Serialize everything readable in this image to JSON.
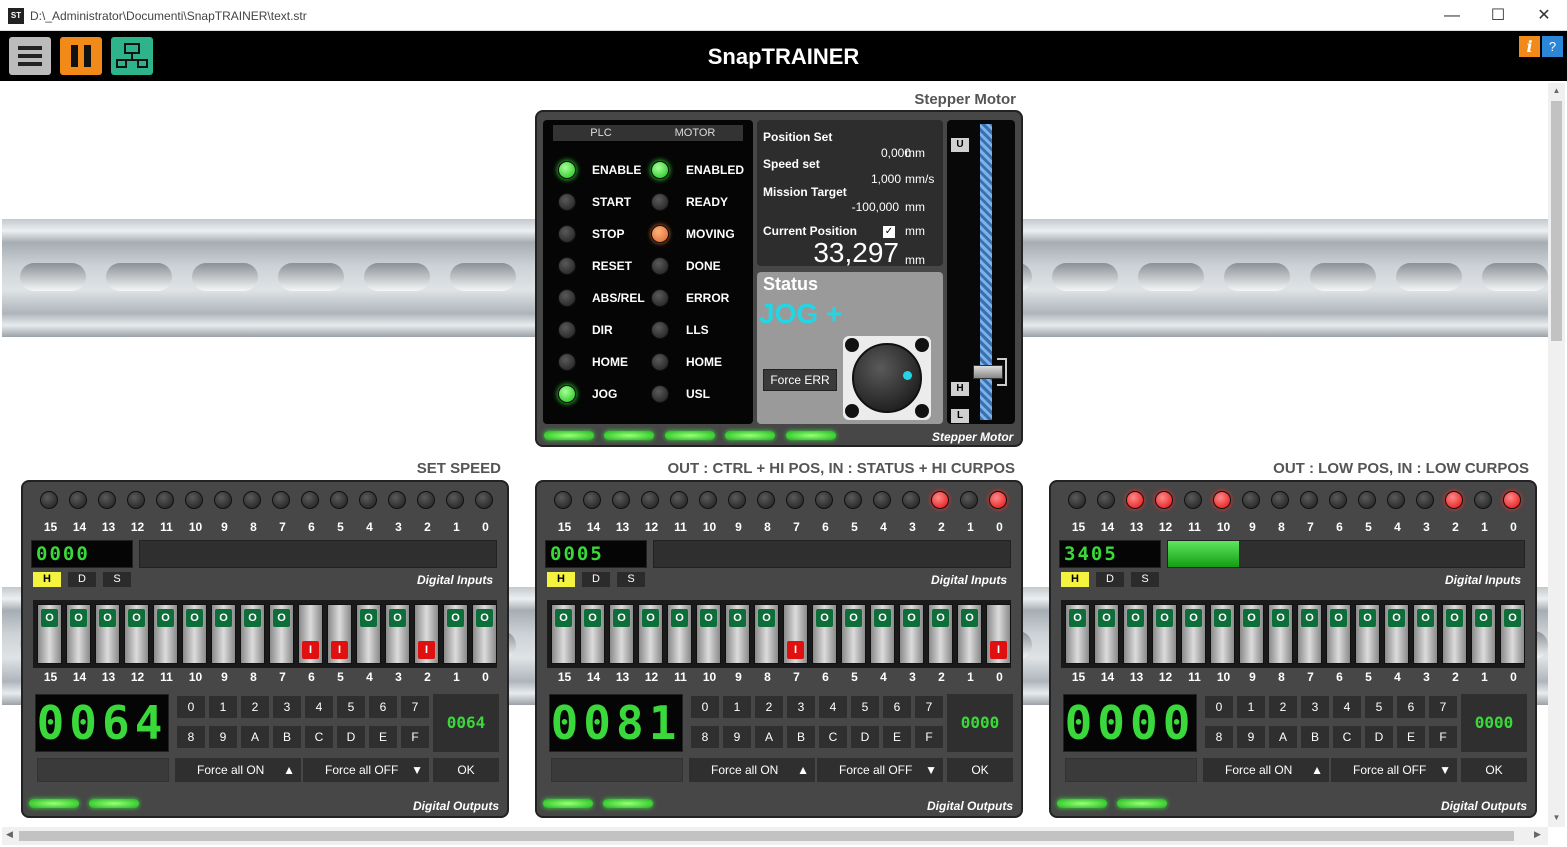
{
  "window": {
    "path": "D:\\_Administrator\\Documenti\\SnapTRAINER\\text.str",
    "app_icon_text": "ST",
    "minimize": "—",
    "maximize": "☐",
    "close": "✕"
  },
  "toolbar": {
    "title": "SnapTRAINER",
    "info_label": "i",
    "help_label": "?"
  },
  "stepper": {
    "heading": "Stepper Motor",
    "footer": "Stepper Motor",
    "plc_header": "PLC",
    "motor_header": "MOTOR",
    "plc_items": [
      {
        "label": "ENABLE",
        "state": "green"
      },
      {
        "label": "START",
        "state": "off"
      },
      {
        "label": "STOP",
        "state": "off"
      },
      {
        "label": "RESET",
        "state": "off"
      },
      {
        "label": "ABS/REL",
        "state": "off"
      },
      {
        "label": "DIR",
        "state": "off"
      },
      {
        "label": "HOME",
        "state": "off"
      },
      {
        "label": "JOG",
        "state": "green"
      }
    ],
    "motor_items": [
      {
        "label": "ENABLED",
        "state": "green"
      },
      {
        "label": "READY",
        "state": "off"
      },
      {
        "label": "MOVING",
        "state": "orange"
      },
      {
        "label": "DONE",
        "state": "off"
      },
      {
        "label": "ERROR",
        "state": "off"
      },
      {
        "label": "LLS",
        "state": "off"
      },
      {
        "label": "HOME",
        "state": "off"
      },
      {
        "label": "USL",
        "state": "off"
      }
    ],
    "position_set_label": "Position Set",
    "position_set_value": "0,000",
    "position_set_unit": "mm",
    "speed_set_label": "Speed set",
    "speed_set_value": "1,000",
    "speed_set_unit": "mm/s",
    "mission_target_label": "Mission Target",
    "mission_target_value": "-100,000",
    "mission_target_unit": "mm",
    "current_position_label": "Current Position",
    "current_position_unit": "mm",
    "current_position_checked": true,
    "current_position_value": "33,297",
    "current_position_value_unit": "mm",
    "status_label": "Status",
    "status_value": "JOG +",
    "force_err_label": "Force ERR",
    "axis_tags": {
      "u": "U",
      "h": "H",
      "l": "L"
    },
    "carriage_position_fraction": 0.83
  },
  "io_panels": [
    {
      "heading": "SET SPEED",
      "leds_on": [],
      "bits": [
        "15",
        "14",
        "13",
        "12",
        "11",
        "10",
        "9",
        "8",
        "7",
        "6",
        "5",
        "4",
        "3",
        "2",
        "1",
        "0"
      ],
      "input_seg": "0000",
      "input_bar_fraction": 0,
      "modes": [
        "H",
        "D",
        "S"
      ],
      "digital_inputs_label": "Digital Inputs",
      "switches_on": [
        6,
        5,
        2
      ],
      "output_seg": "0064",
      "hex_keys": [
        "0",
        "1",
        "2",
        "3",
        "4",
        "5",
        "6",
        "7",
        "8",
        "9",
        "A",
        "B",
        "C",
        "D",
        "E",
        "F"
      ],
      "hex_display": "0064",
      "force_on_label": "Force all ON",
      "force_on_arrow": "▲",
      "force_off_label": "Force all OFF",
      "force_off_arrow": "▼",
      "ok_label": "OK",
      "digital_outputs_label": "Digital Outputs"
    },
    {
      "heading": "OUT : CTRL + HI POS, IN : STATUS + HI CURPOS",
      "leds_on": [
        2,
        0
      ],
      "bits": [
        "15",
        "14",
        "13",
        "12",
        "11",
        "10",
        "9",
        "8",
        "7",
        "6",
        "5",
        "4",
        "3",
        "2",
        "1",
        "0"
      ],
      "input_seg": "0005",
      "input_bar_fraction": 0,
      "modes": [
        "H",
        "D",
        "S"
      ],
      "digital_inputs_label": "Digital Inputs",
      "switches_on": [
        7,
        0
      ],
      "output_seg": "0081",
      "hex_keys": [
        "0",
        "1",
        "2",
        "3",
        "4",
        "5",
        "6",
        "7",
        "8",
        "9",
        "A",
        "B",
        "C",
        "D",
        "E",
        "F"
      ],
      "hex_display": "0000",
      "force_on_label": "Force all ON",
      "force_on_arrow": "▲",
      "force_off_label": "Force all OFF",
      "force_off_arrow": "▼",
      "ok_label": "OK",
      "digital_outputs_label": "Digital Outputs"
    },
    {
      "heading": "OUT : LOW POS, IN : LOW CURPOS",
      "leds_on": [
        13,
        12,
        10,
        2,
        0
      ],
      "bits": [
        "15",
        "14",
        "13",
        "12",
        "11",
        "10",
        "9",
        "8",
        "7",
        "6",
        "5",
        "4",
        "3",
        "2",
        "1",
        "0"
      ],
      "input_seg": "3405",
      "input_bar_fraction": 0.2,
      "modes": [
        "H",
        "D",
        "S"
      ],
      "digital_inputs_label": "Digital Inputs",
      "switches_on": [],
      "output_seg": "0000",
      "hex_keys": [
        "0",
        "1",
        "2",
        "3",
        "4",
        "5",
        "6",
        "7",
        "8",
        "9",
        "A",
        "B",
        "C",
        "D",
        "E",
        "F"
      ],
      "hex_display": "0000",
      "force_on_label": "Force all ON",
      "force_on_arrow": "▲",
      "force_off_label": "Force all OFF",
      "force_off_arrow": "▼",
      "ok_label": "OK",
      "digital_outputs_label": "Digital Outputs"
    }
  ],
  "colors": {
    "led_green": "#14c214",
    "led_red": "#e30b0b",
    "led_orange": "#d9662a",
    "status_cyan": "#22d6e6",
    "seg_green": "#3ad83a"
  }
}
